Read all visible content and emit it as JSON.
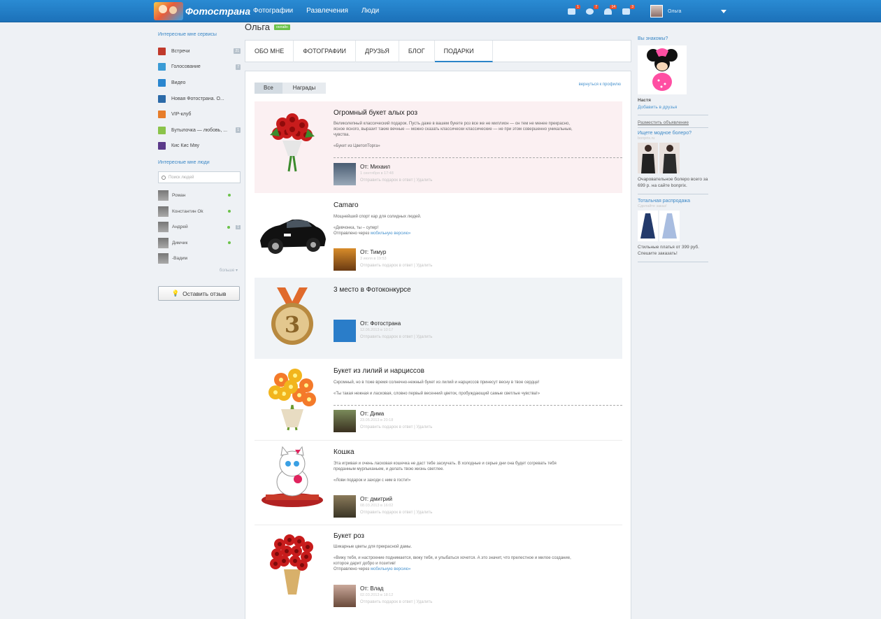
{
  "header": {
    "logo_text": "Фотострана",
    "nav": [
      "Фотографии",
      "Развлечения",
      "Люди"
    ],
    "icons": [
      {
        "name": "news-icon",
        "count": "1"
      },
      {
        "name": "events-icon",
        "count": "7"
      },
      {
        "name": "friends-icon",
        "count": "14"
      },
      {
        "name": "messages-icon",
        "count": "3"
      }
    ],
    "user_name": "Ольга"
  },
  "left": {
    "services_title": "Интересные мне сервисы",
    "services": [
      {
        "label": "Встречи",
        "badge": "21",
        "color": "#c0392b"
      },
      {
        "label": "Голосование",
        "badge": "7",
        "color": "#3a9bd5"
      },
      {
        "label": "Видео",
        "badge": "",
        "color": "#2a86cf"
      },
      {
        "label": "Новая Фотострана. О...",
        "badge": "",
        "color": "#2b6aa8"
      },
      {
        "label": "VIP-клуб",
        "badge": "",
        "color": "#e77d2a"
      },
      {
        "label": "Бутылочка — любовь, ...",
        "badge": "1",
        "color": "#8bc34a"
      },
      {
        "label": "Кис Кис Мяу",
        "badge": "",
        "color": "#5b3a8a"
      }
    ],
    "people_title": "Интересные мне люди",
    "search_placeholder": "Поиск людей",
    "people": [
      {
        "name": "Роман",
        "badge": ""
      },
      {
        "name": "Константин Ok",
        "badge": ""
      },
      {
        "name": "Андрей",
        "badge": "1"
      },
      {
        "name": "Димчик",
        "badge": ""
      },
      {
        "name": "-Вадим",
        "badge": ""
      }
    ],
    "more_label": "больше",
    "feedback_label": "Оставить отзыв"
  },
  "profile": {
    "name": "Ольга",
    "online_label": "онлайн",
    "tabs": [
      "ОБО МНЕ",
      "ФОТОГРАФИИ",
      "ДРУЗЬЯ",
      "БЛОГ",
      "ПОДАРКИ"
    ],
    "active_tab": 4
  },
  "gifts_panel": {
    "filters": [
      "Все",
      "Награды"
    ],
    "active_filter": 0,
    "back_link": "вернуться к профилю",
    "action_reply": "Отправить подарок в ответ",
    "action_divider": "|",
    "action_delete": "Удалить",
    "gifts": [
      {
        "title": "Огромный букет алых роз",
        "desc": "Великолепный классический подарок. Пусть даже в вашем букете роз все же не миллион — он тем не менее прекрасно, ясное ясного, выразит такие вечные — можно сказать классически классические — не при этом совершенно уникальные, чувства.\n\n«Букет из ЦветопТорга»",
        "link": "",
        "from": "От: Михаил",
        "date": "1 сентября в 17:48",
        "highlight": "#fbf0f2"
      },
      {
        "title": "Camaro",
        "desc": "Мощнейший спорт кар для солидных людей.\n\n«Девчонка, ты – супер!\nОтправлено через ",
        "link": "мобильную версию»",
        "from": "От: Тимур",
        "date": "3 июля в 19:53",
        "highlight": ""
      },
      {
        "title": "3 место в Фотоконкурсе",
        "desc": "",
        "link": "",
        "from": "От: Фотострана",
        "date": "12.06.2013 в 10:17",
        "highlight": "#f0f3f6"
      },
      {
        "title": "Букет из лилий и нарциссов",
        "desc": "Скромный, но в тоже время солнечно-нежный букет из лилий и нарциссов принесут весну в твое сердце!\n\n«Ты такая нежная и ласковая, словно первый весенний цветок, пробуждающий самые светлые чувства!»",
        "link": "",
        "from": "От: Дима",
        "date": "23.05.2013 в 20:18",
        "highlight": ""
      },
      {
        "title": "Кошка",
        "desc": "Эта игривая и очень ласковая кошечка не даст тебе заскучать. В холодные и серые дни она будет согревать тебя преданным мурлыканьем, и делать твою жизнь светлее.\n\n«Лови подарок и заходи с ним в гости!»",
        "link": "",
        "from": "От: дмитрий",
        "date": "08.03.2013 в 16:02",
        "highlight": ""
      },
      {
        "title": "Букет роз",
        "desc": "Шикарные цветы для прекрасной дамы.\n\n«Вижу тебя, и настроение поднимается, вижу тебя, и улыбаться хочется. А это значит, что прелестное и милое создание, которое дарит добро и позитив!\nОтправлено через ",
        "link": "мобильную версию»",
        "from": "От: Влад",
        "date": "02.03.2013 в 18:12",
        "highlight": ""
      }
    ]
  },
  "right": {
    "know_title": "Вы знакомы?",
    "know_name": "Настя",
    "add_friend": "Добавить в друзья",
    "ad_place": "Разместить объявление",
    "ad1_title": "Ищете модное болеро?",
    "ad1_sub": "bonprix.ru",
    "ad1_text": "Очаровательное болеро всего за 699 р. на сайте bonprix.",
    "ad2_title": "Тотальная распродажа",
    "ad2_sub": "Сделайте заказ!",
    "ad2_text": "Стильные платья от 399 руб. Спешите заказать!"
  }
}
